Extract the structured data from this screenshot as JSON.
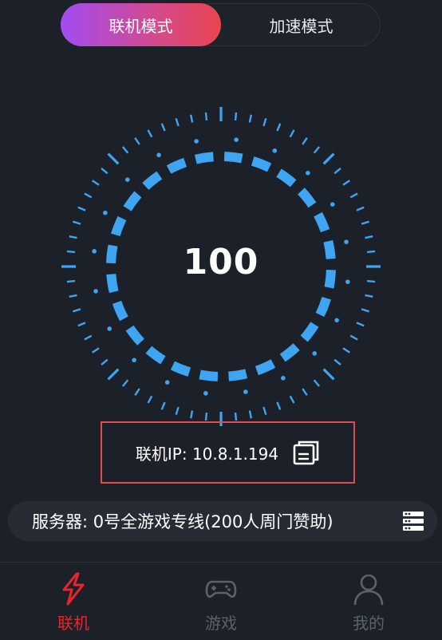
{
  "mode_switch": {
    "active_label": "联机模式",
    "inactive_label": "加速模式"
  },
  "gauge": {
    "value": "100"
  },
  "connection": {
    "ip_text": "联机IP:  10.8.1.194"
  },
  "server": {
    "text": "服务器:  0号全游戏专线(200人周门赞助)"
  },
  "tabs": [
    {
      "label": "联机",
      "icon": "lightning-icon",
      "active": true
    },
    {
      "label": "游戏",
      "icon": "gamepad-icon",
      "active": false
    },
    {
      "label": "我的",
      "icon": "user-icon",
      "active": false
    }
  ],
  "colors": {
    "background": "#1c2129",
    "accent_blue": "#3da5f2",
    "active_red": "#e8262a",
    "gradient_start": "#a24cf1",
    "gradient_end": "#e8454f",
    "highlight_border": "#e24b4f"
  }
}
